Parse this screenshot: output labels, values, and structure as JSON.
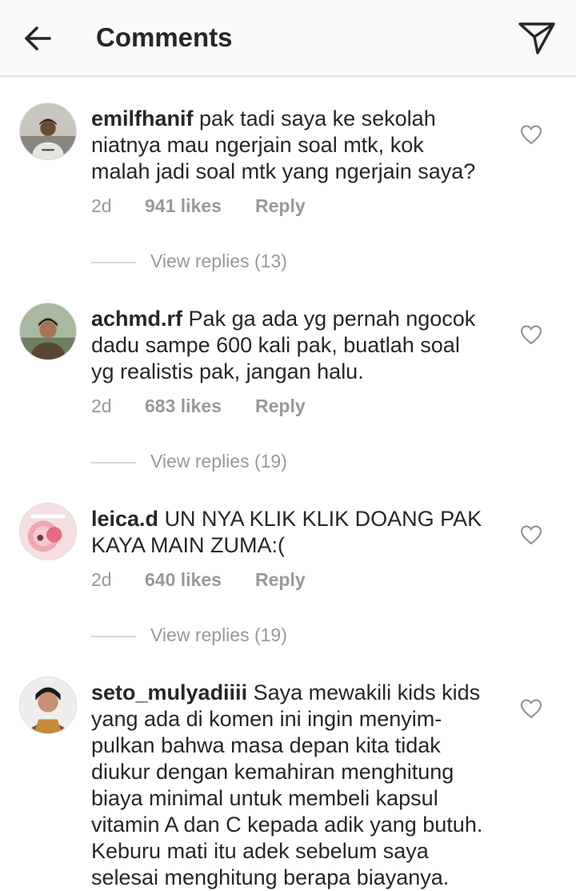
{
  "header": {
    "title": "Comments",
    "back_icon": "arrow-left-icon",
    "send_icon": "paper-plane-icon"
  },
  "comments": [
    {
      "username": "emilfhanif",
      "lines": [
        "pak tadi saya ke sekolah",
        "niatnya mau ngerjain soal mtk, kok",
        "malah jadi soal mtk yang ngerjain saya?"
      ],
      "time": "2d",
      "likes": "941 likes",
      "reply": "Reply",
      "view_replies": "View replies (13)"
    },
    {
      "username": "achmd.rf",
      "lines": [
        "Pak ga ada yg pernah ngocok",
        "dadu sampe 600 kali pak, buatlah soal",
        "yg realistis pak, jangan halu."
      ],
      "time": "2d",
      "likes": "683 likes",
      "reply": "Reply",
      "view_replies": "View replies (19)"
    },
    {
      "username": "leica.d",
      "lines": [
        "UN NYA KLIK KLIK DOANG PAK",
        "KAYA MAIN ZUMA:("
      ],
      "time": "2d",
      "likes": "640 likes",
      "reply": "Reply",
      "view_replies": "View replies (19)"
    },
    {
      "username": "seto_mulyadiiii",
      "lines": [
        "Saya mewakili kids kids",
        "yang ada di komen ini ingin menyim-",
        "pulkan bahwa masa depan kita tidak",
        "diukur dengan kemahiran menghitung",
        "biaya minimal untuk membeli kapsul",
        "vitamin A dan C  kepada adik yang butuh.",
        "Keburu mati itu adek sebelum saya",
        "selesai menghitung berapa biayanya."
      ]
    }
  ],
  "colors": {
    "text": "#262626",
    "meta": "#999999",
    "header_bg": "#fafafa",
    "divider": "#d6d6d6"
  }
}
